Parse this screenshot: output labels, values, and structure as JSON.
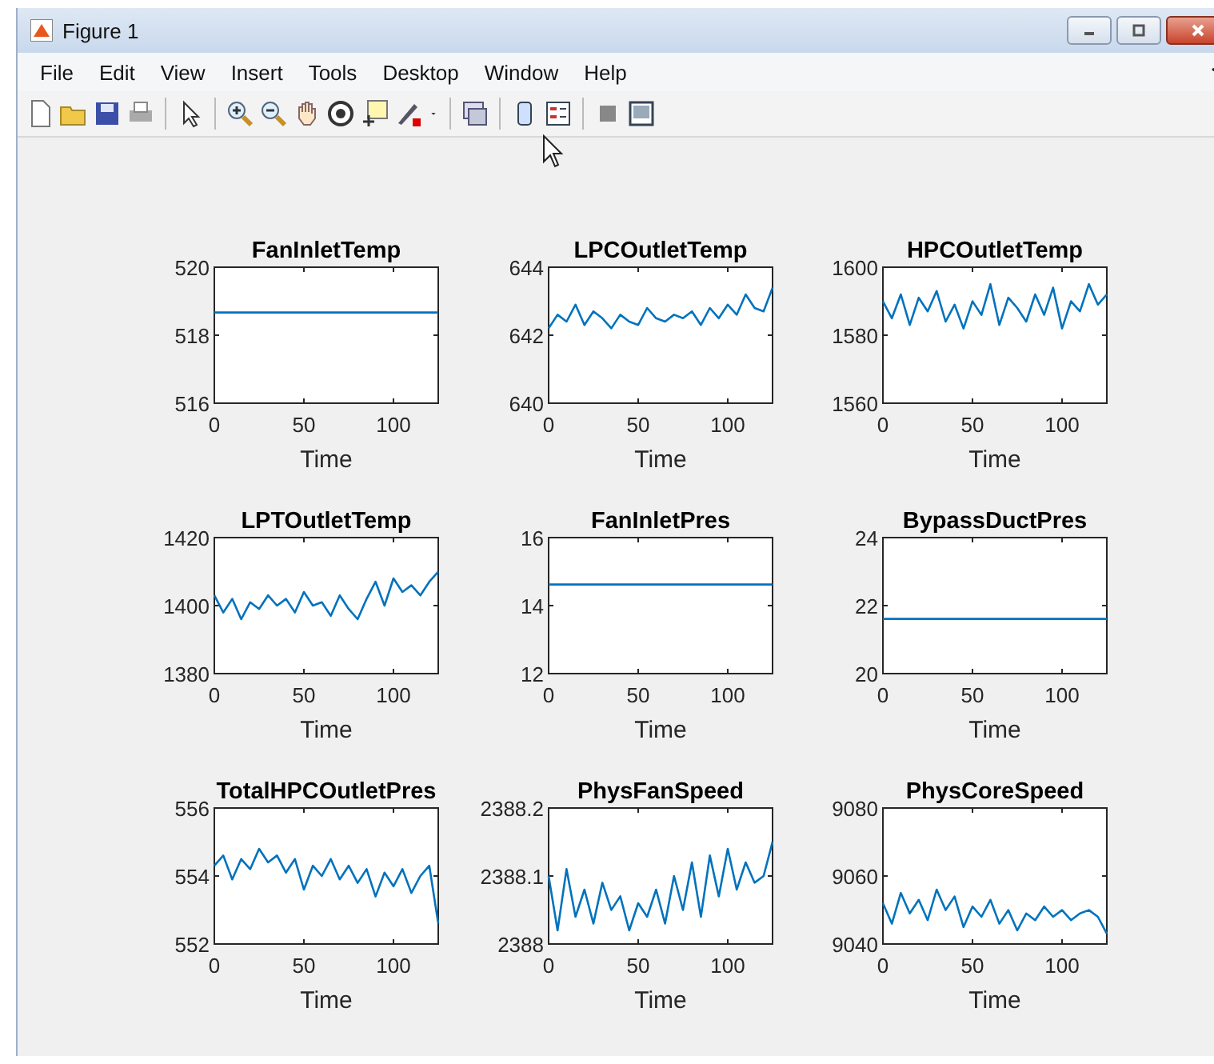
{
  "window": {
    "title": "Figure 1"
  },
  "menu": [
    "File",
    "Edit",
    "View",
    "Insert",
    "Tools",
    "Desktop",
    "Window",
    "Help"
  ],
  "subplots": [
    {
      "chart_data": {
        "type": "line",
        "title": "FanInletTemp",
        "xlabel": "Time",
        "x": [
          0,
          125
        ],
        "series": [
          {
            "color": "#0072bd",
            "values": [
              518.67,
              518.67
            ]
          }
        ],
        "xlim": [
          0,
          125
        ],
        "ylim": [
          516,
          520
        ],
        "xticks": [
          0,
          50,
          100
        ],
        "yticks": [
          516,
          518,
          520
        ]
      }
    },
    {
      "chart_data": {
        "type": "line",
        "title": "LPCOutletTemp",
        "xlabel": "Time",
        "x": [
          0,
          5,
          10,
          15,
          20,
          25,
          30,
          35,
          40,
          45,
          50,
          55,
          60,
          65,
          70,
          75,
          80,
          85,
          90,
          95,
          100,
          105,
          110,
          115,
          120,
          125
        ],
        "series": [
          {
            "color": "#0072bd",
            "values": [
              642.2,
              642.6,
              642.4,
              642.9,
              642.3,
              642.7,
              642.5,
              642.2,
              642.6,
              642.4,
              642.3,
              642.8,
              642.5,
              642.4,
              642.6,
              642.5,
              642.7,
              642.3,
              642.8,
              642.5,
              642.9,
              642.6,
              643.2,
              642.8,
              642.7,
              643.4
            ]
          }
        ],
        "xlim": [
          0,
          125
        ],
        "ylim": [
          640,
          644
        ],
        "xticks": [
          0,
          50,
          100
        ],
        "yticks": [
          640,
          642,
          644
        ]
      }
    },
    {
      "chart_data": {
        "type": "line",
        "title": "HPCOutletTemp",
        "xlabel": "Time",
        "x": [
          0,
          5,
          10,
          15,
          20,
          25,
          30,
          35,
          40,
          45,
          50,
          55,
          60,
          65,
          70,
          75,
          80,
          85,
          90,
          95,
          100,
          105,
          110,
          115,
          120,
          125
        ],
        "series": [
          {
            "color": "#0072bd",
            "values": [
              1590,
              1585,
              1592,
              1583,
              1591,
              1587,
              1593,
              1584,
              1589,
              1582,
              1590,
              1586,
              1595,
              1583,
              1591,
              1588,
              1584,
              1592,
              1586,
              1594,
              1582,
              1590,
              1587,
              1595,
              1589,
              1592
            ]
          }
        ],
        "xlim": [
          0,
          125
        ],
        "ylim": [
          1560,
          1600
        ],
        "xticks": [
          0,
          50,
          100
        ],
        "yticks": [
          1560,
          1580,
          1600
        ]
      }
    },
    {
      "chart_data": {
        "type": "line",
        "title": "LPTOutletTemp",
        "xlabel": "Time",
        "x": [
          0,
          5,
          10,
          15,
          20,
          25,
          30,
          35,
          40,
          45,
          50,
          55,
          60,
          65,
          70,
          75,
          80,
          85,
          90,
          95,
          100,
          105,
          110,
          115,
          120,
          125
        ],
        "series": [
          {
            "color": "#0072bd",
            "values": [
              1403,
              1398,
              1402,
              1396,
              1401,
              1399,
              1403,
              1400,
              1402,
              1398,
              1404,
              1400,
              1401,
              1397,
              1403,
              1399,
              1396,
              1402,
              1407,
              1400,
              1408,
              1404,
              1406,
              1403,
              1407,
              1410
            ]
          }
        ],
        "xlim": [
          0,
          125
        ],
        "ylim": [
          1380,
          1420
        ],
        "xticks": [
          0,
          50,
          100
        ],
        "yticks": [
          1380,
          1400,
          1420
        ]
      }
    },
    {
      "chart_data": {
        "type": "line",
        "title": "FanInletPres",
        "xlabel": "Time",
        "x": [
          0,
          125
        ],
        "series": [
          {
            "color": "#0072bd",
            "values": [
              14.62,
              14.62
            ]
          }
        ],
        "xlim": [
          0,
          125
        ],
        "ylim": [
          12,
          16
        ],
        "xticks": [
          0,
          50,
          100
        ],
        "yticks": [
          12,
          14,
          16
        ]
      }
    },
    {
      "chart_data": {
        "type": "line",
        "title": "BypassDuctPres",
        "xlabel": "Time",
        "x": [
          0,
          125
        ],
        "series": [
          {
            "color": "#0072bd",
            "values": [
              21.61,
              21.61
            ]
          }
        ],
        "xlim": [
          0,
          125
        ],
        "ylim": [
          20,
          24
        ],
        "xticks": [
          0,
          50,
          100
        ],
        "yticks": [
          20,
          22,
          24
        ]
      }
    },
    {
      "chart_data": {
        "type": "line",
        "title": "TotalHPCOutletPres",
        "xlabel": "Time",
        "x": [
          0,
          5,
          10,
          15,
          20,
          25,
          30,
          35,
          40,
          45,
          50,
          55,
          60,
          65,
          70,
          75,
          80,
          85,
          90,
          95,
          100,
          105,
          110,
          115,
          120,
          125
        ],
        "series": [
          {
            "color": "#0072bd",
            "values": [
              554.3,
              554.6,
              553.9,
              554.5,
              554.2,
              554.8,
              554.4,
              554.6,
              554.1,
              554.5,
              553.6,
              554.3,
              554.0,
              554.5,
              553.9,
              554.3,
              553.8,
              554.2,
              553.4,
              554.1,
              553.7,
              554.2,
              553.5,
              554.0,
              554.3,
              552.6
            ]
          }
        ],
        "xlim": [
          0,
          125
        ],
        "ylim": [
          552,
          556
        ],
        "xticks": [
          0,
          50,
          100
        ],
        "yticks": [
          552,
          554,
          556
        ]
      }
    },
    {
      "chart_data": {
        "type": "line",
        "title": "PhysFanSpeed",
        "xlabel": "Time",
        "x": [
          0,
          5,
          10,
          15,
          20,
          25,
          30,
          35,
          40,
          45,
          50,
          55,
          60,
          65,
          70,
          75,
          80,
          85,
          90,
          95,
          100,
          105,
          110,
          115,
          120,
          125
        ],
        "series": [
          {
            "color": "#0072bd",
            "values": [
              2388.1,
              2388.02,
              2388.11,
              2388.04,
              2388.08,
              2388.03,
              2388.09,
              2388.05,
              2388.07,
              2388.02,
              2388.06,
              2388.04,
              2388.08,
              2388.03,
              2388.1,
              2388.05,
              2388.12,
              2388.04,
              2388.13,
              2388.07,
              2388.14,
              2388.08,
              2388.12,
              2388.09,
              2388.1,
              2388.15
            ]
          }
        ],
        "xlim": [
          0,
          125
        ],
        "ylim": [
          2388,
          2388.2
        ],
        "xticks": [
          0,
          50,
          100
        ],
        "yticks": [
          2388,
          2388.1,
          2388.2
        ]
      }
    },
    {
      "chart_data": {
        "type": "line",
        "title": "PhysCoreSpeed",
        "xlabel": "Time",
        "x": [
          0,
          5,
          10,
          15,
          20,
          25,
          30,
          35,
          40,
          45,
          50,
          55,
          60,
          65,
          70,
          75,
          80,
          85,
          90,
          95,
          100,
          105,
          110,
          115,
          120,
          125
        ],
        "series": [
          {
            "color": "#0072bd",
            "values": [
              9052,
              9046,
              9055,
              9049,
              9053,
              9047,
              9056,
              9050,
              9054,
              9045,
              9051,
              9048,
              9053,
              9046,
              9050,
              9044,
              9049,
              9047,
              9051,
              9048,
              9050,
              9047,
              9049,
              9050,
              9048,
              9043
            ]
          }
        ],
        "xlim": [
          0,
          125
        ],
        "ylim": [
          9040,
          9080
        ],
        "xticks": [
          0,
          50,
          100
        ],
        "yticks": [
          9040,
          9060,
          9080
        ]
      }
    }
  ]
}
